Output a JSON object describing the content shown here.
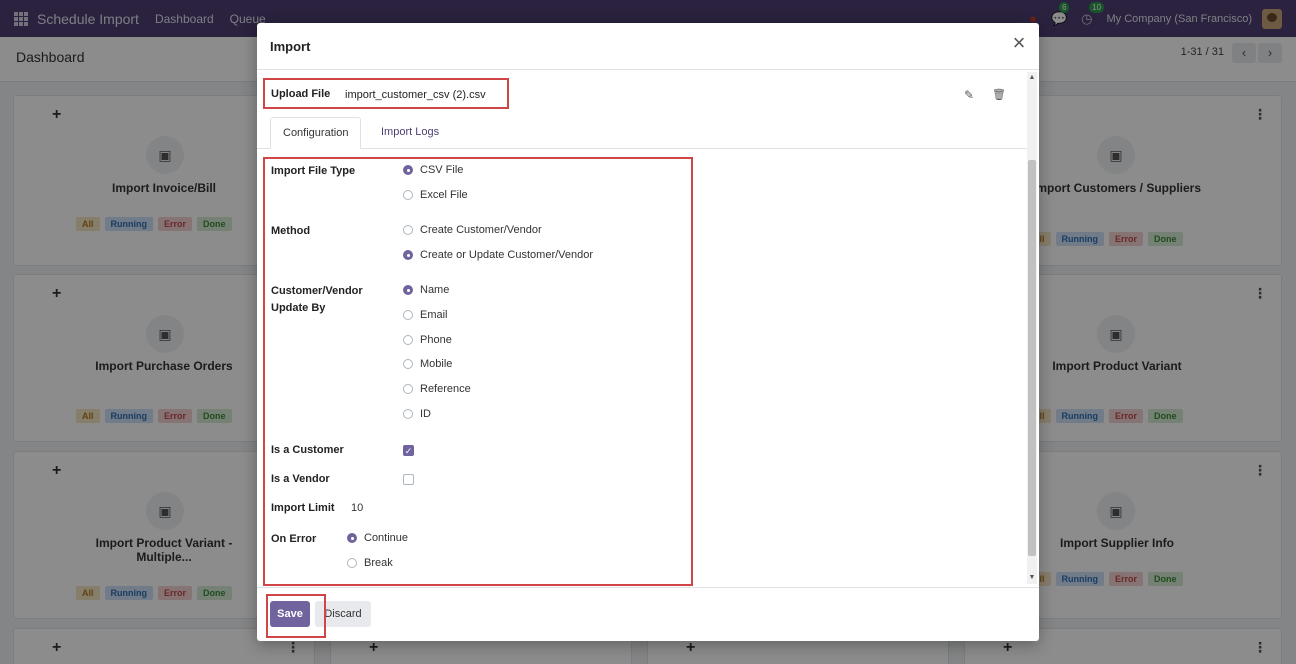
{
  "navbar": {
    "brand": "Schedule Import",
    "links": [
      "Dashboard",
      "Queue"
    ],
    "chat_badge": "6",
    "activity_badge": "10",
    "company": "My Company (San Francisco)"
  },
  "control_panel": {
    "title": "Dashboard",
    "pager": "1-31 / 31",
    "prev": "‹",
    "next": "›"
  },
  "cards": [
    {
      "title": "Import Invoice/Bill"
    },
    {
      "title": "Import Customers / Suppliers"
    },
    {
      "title": "Import Purchase Orders"
    },
    {
      "title": "Import Product Variant"
    },
    {
      "title": "Import Product Variant - Multiple..."
    },
    {
      "title": "Import Supplier Info"
    }
  ],
  "badges": {
    "all": "All",
    "running": "Running",
    "error": "Error",
    "done": "Done"
  },
  "modal": {
    "title": "Import",
    "close": "×",
    "upload_label": "Upload File",
    "upload_value": "import_customer_csv (2).csv",
    "tabs": {
      "configuration": "Configuration",
      "logs": "Import Logs"
    },
    "file_type": {
      "label": "Import File Type",
      "options": [
        "CSV File",
        "Excel File"
      ],
      "selected": "CSV File"
    },
    "method": {
      "label": "Method",
      "options": [
        "Create Customer/Vendor",
        "Create or Update Customer/Vendor"
      ],
      "selected": "Create or Update Customer/Vendor"
    },
    "update_by": {
      "label": "Customer/Vendor Update By",
      "options": [
        "Name",
        "Email",
        "Phone",
        "Mobile",
        "Reference",
        "ID"
      ],
      "selected": "Name"
    },
    "is_customer": {
      "label": "Is a Customer",
      "checked": true
    },
    "is_vendor": {
      "label": "Is a Vendor",
      "checked": false
    },
    "import_limit": {
      "label": "Import Limit",
      "value": "10"
    },
    "on_error": {
      "label": "On Error",
      "options": [
        "Continue",
        "Break"
      ],
      "selected": "Continue"
    },
    "save": "Save",
    "discard": "Discard"
  },
  "colors": {
    "navbar": "#4e3f72",
    "primary": "#71639e",
    "highlight": "#d04545"
  }
}
